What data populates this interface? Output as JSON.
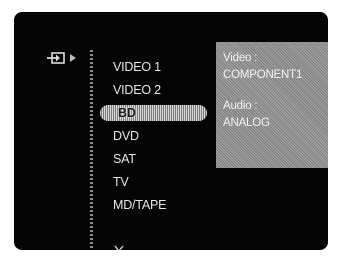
{
  "input_menu": {
    "items": [
      {
        "label": "VIDEO 1",
        "selected": false
      },
      {
        "label": "VIDEO 2",
        "selected": false
      },
      {
        "label": "BD",
        "selected": true
      },
      {
        "label": "DVD",
        "selected": false
      },
      {
        "label": "SAT",
        "selected": false
      },
      {
        "label": "TV",
        "selected": false
      },
      {
        "label": "MD/TAPE",
        "selected": false
      }
    ],
    "icon": "input-select-icon",
    "more_icon": "chevron-down-icon"
  },
  "info_panel": {
    "video_label": "Video :",
    "video_value": "COMPONENT1",
    "audio_label": "Audio :",
    "audio_value": "ANALOG"
  }
}
